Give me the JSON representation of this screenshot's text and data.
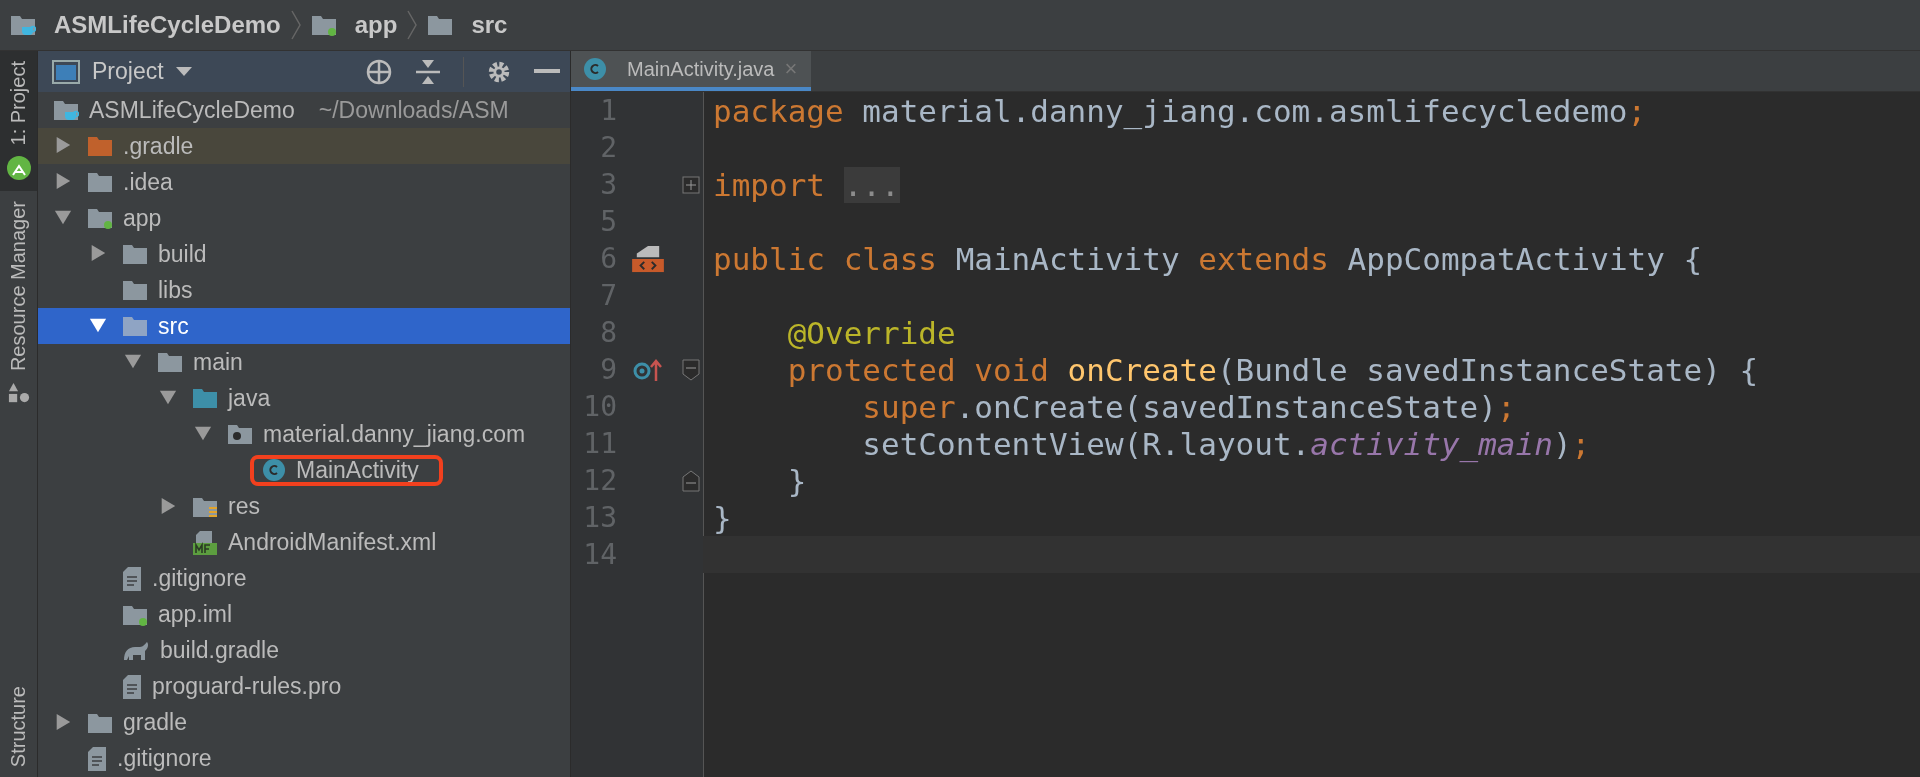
{
  "breadcrumb": [
    {
      "label": "ASMLifeCycleDemo",
      "kind": "project"
    },
    {
      "label": "app",
      "kind": "module"
    },
    {
      "label": "src",
      "kind": "folder"
    }
  ],
  "tool_stripe": [
    {
      "label": "1: Project",
      "kind": "project",
      "selected": true
    },
    {
      "label": "Resource Manager",
      "kind": "resources",
      "selected": false
    },
    {
      "label": "Structure",
      "kind": "structure",
      "selected": false
    }
  ],
  "project_panel": {
    "title": "Project",
    "tree": [
      {
        "label": "ASMLifeCycleDemo",
        "path": "~/Downloads/ASM",
        "kind": "project",
        "selected": false,
        "children": [
          {
            "label": ".gradle",
            "kind": "excluded-folder",
            "expanded": false,
            "selected": false,
            "highlighted": true
          },
          {
            "label": ".idea",
            "kind": "folder",
            "expanded": false,
            "selected": false
          },
          {
            "label": "app",
            "kind": "module",
            "expanded": true,
            "selected": false,
            "children": [
              {
                "label": "build",
                "kind": "folder",
                "expanded": false,
                "selected": false
              },
              {
                "label": "libs",
                "kind": "folder",
                "selected": false
              },
              {
                "label": "src",
                "kind": "folder",
                "expanded": true,
                "selected": true,
                "children": [
                  {
                    "label": "main",
                    "kind": "folder",
                    "expanded": true,
                    "selected": false,
                    "children": [
                      {
                        "label": "java",
                        "kind": "source-folder",
                        "expanded": true,
                        "selected": false,
                        "children": [
                          {
                            "label": "material.danny_jiang.com",
                            "kind": "package",
                            "expanded": true,
                            "selected": false,
                            "children": [
                              {
                                "label": "MainActivity",
                                "kind": "class",
                                "selected": false,
                                "annotated": true
                              }
                            ]
                          }
                        ]
                      },
                      {
                        "label": "res",
                        "kind": "res-folder",
                        "expanded": false,
                        "selected": false
                      },
                      {
                        "label": "AndroidManifest.xml",
                        "kind": "manifest",
                        "selected": false
                      }
                    ]
                  }
                ]
              },
              {
                "label": ".gitignore",
                "kind": "file",
                "selected": false
              },
              {
                "label": "app.iml",
                "kind": "iml",
                "selected": false
              },
              {
                "label": "build.gradle",
                "kind": "gradle",
                "selected": false
              },
              {
                "label": "proguard-rules.pro",
                "kind": "file",
                "selected": false
              }
            ]
          },
          {
            "label": "gradle",
            "kind": "folder",
            "expanded": false,
            "selected": false
          },
          {
            "label": ".gitignore",
            "kind": "file",
            "selected": false
          }
        ]
      }
    ]
  },
  "editor": {
    "tabs": [
      {
        "label": "MainActivity.java",
        "kind": "class",
        "selected": true,
        "close": "×"
      }
    ],
    "lines": [
      {
        "number": "1",
        "tokens": [
          {
            "kind": "keyword",
            "text": "package"
          },
          {
            "kind": "plain",
            "text": " material.danny_jiang.com.asmlifecycledemo"
          },
          {
            "kind": "keyword",
            "text": ";"
          }
        ]
      },
      {
        "number": "2"
      },
      {
        "number": "3",
        "fold_mark": {
          "kind": "collapsed"
        },
        "tokens": [
          {
            "kind": "keyword",
            "text": "import "
          },
          {
            "kind": "folded",
            "text": "..."
          }
        ]
      },
      {
        "number": "5"
      },
      {
        "number": "6",
        "gutter_mark": {
          "kind": "implemented"
        },
        "tokens": [
          {
            "kind": "keyword",
            "text": "public class"
          },
          {
            "kind": "plain",
            "text": " MainActivity "
          },
          {
            "kind": "keyword",
            "text": "extends"
          },
          {
            "kind": "plain",
            "text": " AppCompatActivity {"
          }
        ]
      },
      {
        "number": "7"
      },
      {
        "number": "8",
        "tokens": [
          {
            "kind": "annotation",
            "text": "    @Override"
          }
        ]
      },
      {
        "number": "9",
        "gutter_mark": {
          "kind": "overrides"
        },
        "fold_mark": {
          "kind": "open"
        },
        "tokens": [
          {
            "kind": "keyword",
            "text": "    protected void "
          },
          {
            "kind": "method",
            "text": "onCreate"
          },
          {
            "kind": "plain",
            "text": "(Bundle savedInstanceState) {"
          }
        ]
      },
      {
        "number": "10",
        "tokens": [
          {
            "kind": "keyword",
            "text": "        super"
          },
          {
            "kind": "plain",
            "text": ".onCreate(savedInstanceState)"
          },
          {
            "kind": "keyword",
            "text": ";"
          }
        ]
      },
      {
        "number": "11",
        "tokens": [
          {
            "kind": "plain",
            "text": "        setContentView(R.layout."
          },
          {
            "kind": "field",
            "text": "activity_main"
          },
          {
            "kind": "plain",
            "text": ")"
          },
          {
            "kind": "keyword",
            "text": ";"
          }
        ]
      },
      {
        "number": "12",
        "fold_mark": {
          "kind": "end"
        },
        "tokens": [
          {
            "kind": "plain",
            "text": "    }"
          }
        ]
      },
      {
        "number": "13",
        "tokens": [
          {
            "kind": "plain",
            "text": "}"
          }
        ]
      },
      {
        "number": "14",
        "current": true
      }
    ]
  }
}
